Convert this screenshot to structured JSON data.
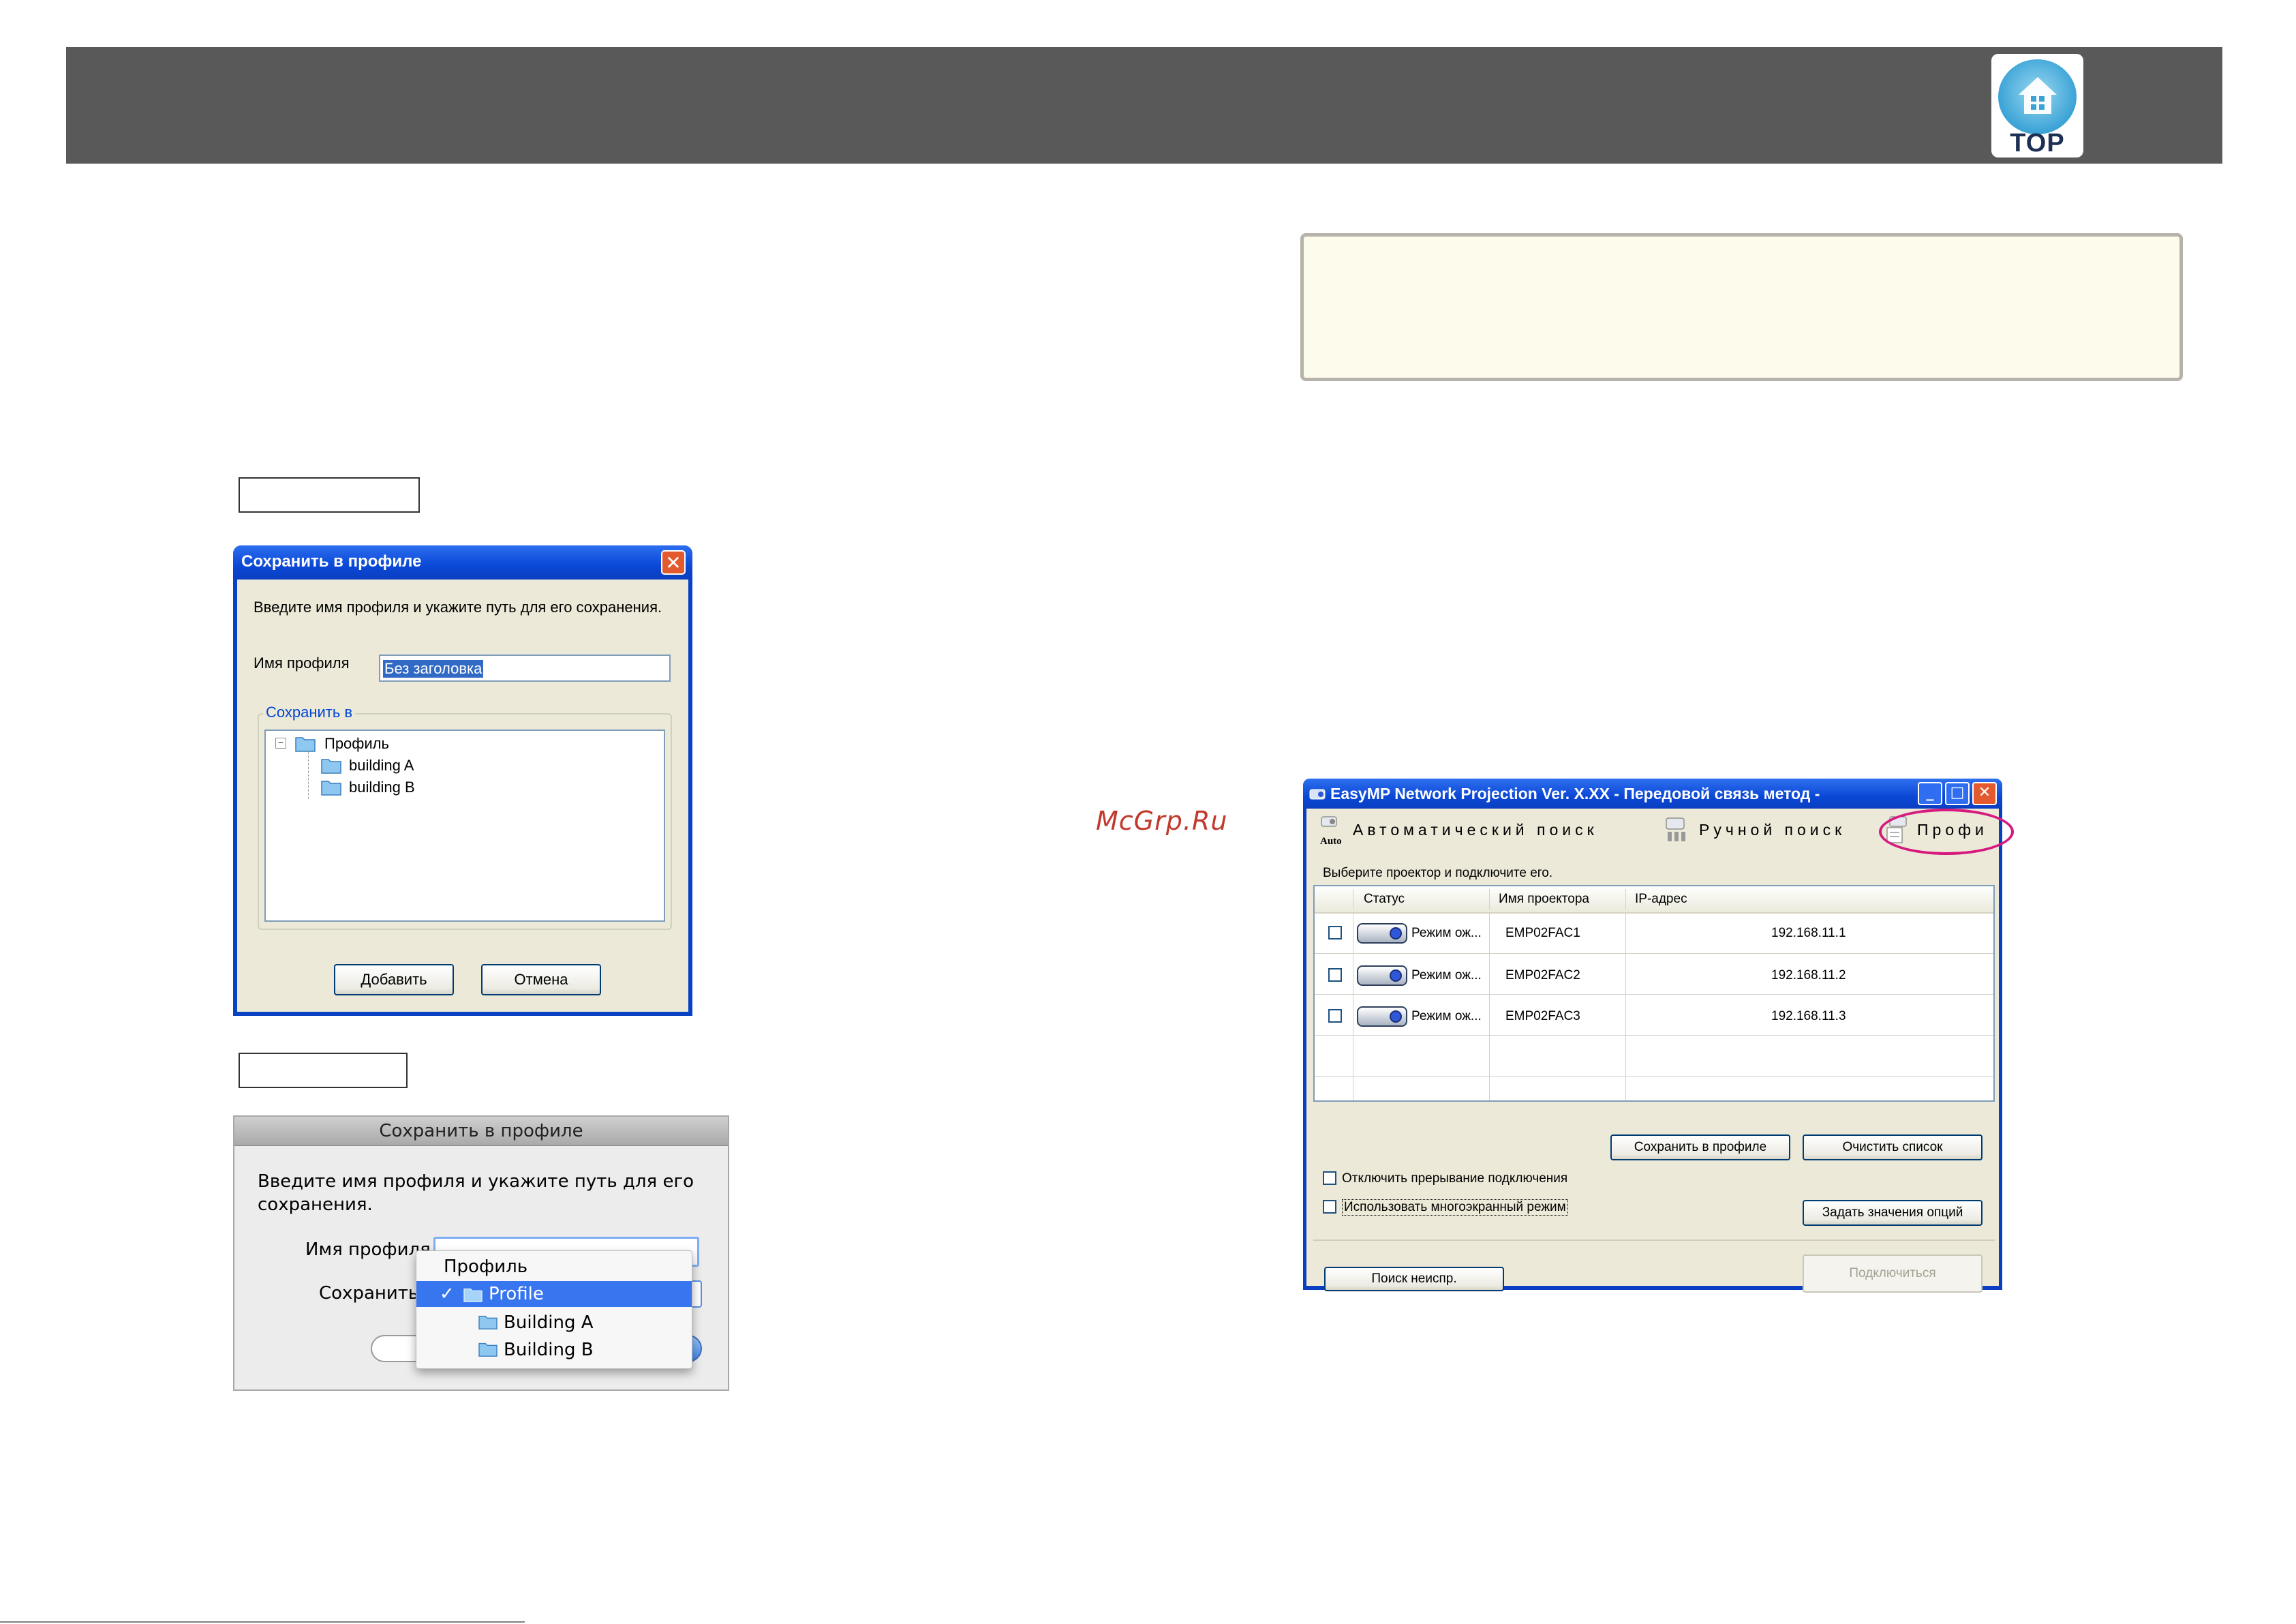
{
  "header": {
    "logo_text": "TOP"
  },
  "watermark": "McGrp.Ru",
  "win_dialog": {
    "title": "Сохранить в профиле",
    "instruction": "Введите имя профиля и укажите путь для его сохранения.",
    "profile_name_label": "Имя профиля",
    "profile_name_value": "Без заголовка",
    "save_in_label": "Сохранить в",
    "tree": {
      "root": "Профиль",
      "children": [
        "building A",
        "building B"
      ]
    },
    "add_button": "Добавить",
    "cancel_button": "Отмена"
  },
  "mac_dialog": {
    "title": "Сохранить в профиле",
    "instruction_line1": "Введите имя профиля и укажите путь для его",
    "instruction_line2": "сохранения.",
    "profile_name_label": "Имя профиля",
    "save_label": "Сохранить",
    "menu": {
      "header": "Профиль",
      "selected": "Profile",
      "checkmark": "✓",
      "items": [
        "Building A",
        "Building B"
      ]
    }
  },
  "easymp": {
    "title": "EasyMP Network Projection Ver. X.XX - Передовой связь метод -",
    "toolbar": {
      "auto_badge": "Auto",
      "auto_search": "Автоматический поиск",
      "manual_search": "Ручной поиск",
      "profile": "Профи"
    },
    "instruction": "Выберите проектор и подключите его.",
    "columns": [
      "Статус",
      "Имя проектора",
      "IP-адрес"
    ],
    "rows": [
      {
        "status": "Режим ож...",
        "name": "EMP02FAC1",
        "ip": "192.168.11.1"
      },
      {
        "status": "Режим ож...",
        "name": "EMP02FAC2",
        "ip": "192.168.11.2"
      },
      {
        "status": "Режим ож...",
        "name": "EMP02FAC3",
        "ip": "192.168.11.3"
      }
    ],
    "save_profile_button": "Сохранить в профиле",
    "clear_list_button": "Очистить список",
    "disable_interrupt_label": "Отключить прерывание подключения",
    "multiscreen_label": "Использовать многоэкранный режим",
    "set_options_button": "Задать значения опций",
    "search_unused_button": "Поиск неиспр.",
    "connect_button": "Подключиться",
    "highlight_color": "#d6197f"
  }
}
